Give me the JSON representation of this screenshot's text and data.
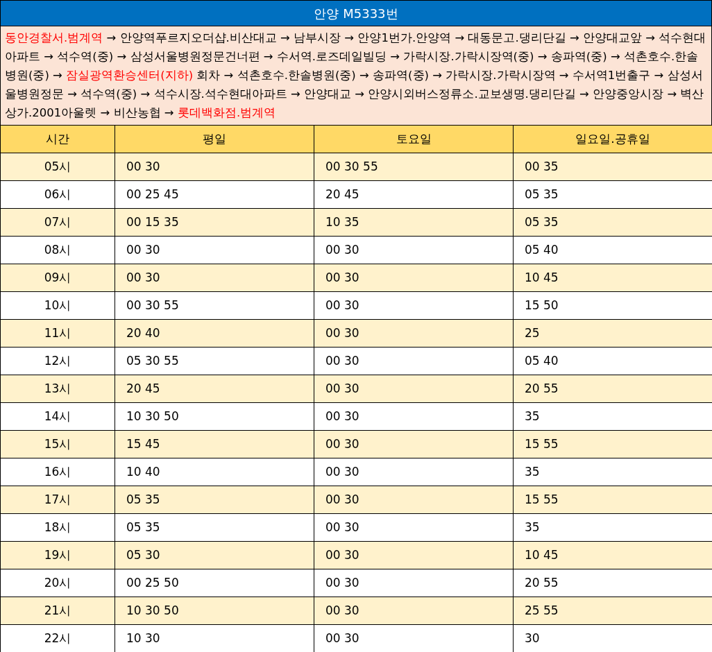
{
  "title": "안양 M5333번",
  "route": {
    "segments": [
      {
        "text": "동안경찰서.범계역",
        "highlight": true
      },
      {
        "text": " → 안양역푸르지오더샵.비산대교 → 남부시장 → 안양1번가.안양역 → 대동문고.댕리단길 → 안양대교앞 → 석수현대아파트 → 석수역(중) → 삼성서울병원정문건너편 → 수서역.로즈데일빌딩 → 가락시장.가락시장역(중) → 송파역(중) → 석촌호수.한솔병원(중) → ",
        "highlight": false
      },
      {
        "text": "잠실광역환승센터(지하)",
        "highlight": true
      },
      {
        "text": " 회차 → 석촌호수.한솔병원(중) → 송파역(중) → 가락시장.가락시장역 → 수서역1번출구 → 삼성서울병원정문 → 석수역(중) → 석수시장.석수현대아파트 → 안양대교 → 안양시외버스정류소.교보생명.댕리단길 → 안양중앙시장 → 벽산상가.2001아울렛 → 비산농협 → ",
        "highlight": false
      },
      {
        "text": "롯데백화점.범계역",
        "highlight": true
      }
    ]
  },
  "table": {
    "columns": [
      "시간",
      "평일",
      "토요일",
      "일요일.공휴일"
    ],
    "rows": [
      [
        "05시",
        "00 30",
        "00 30 55",
        "00 35"
      ],
      [
        "06시",
        "00 25 45",
        "20 45",
        "05 35"
      ],
      [
        "07시",
        "00 15 35",
        "10 35",
        "05 35"
      ],
      [
        "08시",
        "00 30",
        "00 30",
        "05 40"
      ],
      [
        "09시",
        "00 30",
        "00 30",
        "10 45"
      ],
      [
        "10시",
        "00 30 55",
        "00 30",
        "15 50"
      ],
      [
        "11시",
        "20 40",
        "00 30",
        "25"
      ],
      [
        "12시",
        "05 30 55",
        "00 30",
        "05 40"
      ],
      [
        "13시",
        "20 45",
        "00 30",
        "20 55"
      ],
      [
        "14시",
        "10 30 50",
        "00 30",
        "35"
      ],
      [
        "15시",
        "15 45",
        "00 30",
        "15 55"
      ],
      [
        "16시",
        "10 40",
        "00 30",
        "35"
      ],
      [
        "17시",
        "05 35",
        "00 30",
        "15 55"
      ],
      [
        "18시",
        "05 35",
        "00 30",
        "35"
      ],
      [
        "19시",
        "05 30",
        "00 30",
        "10 45"
      ],
      [
        "20시",
        "00 25 50",
        "00 30",
        "20 55"
      ],
      [
        "21시",
        "10 30 50",
        "00 30",
        "25 55"
      ],
      [
        "22시",
        "10 30",
        "00 30",
        "30"
      ]
    ]
  }
}
